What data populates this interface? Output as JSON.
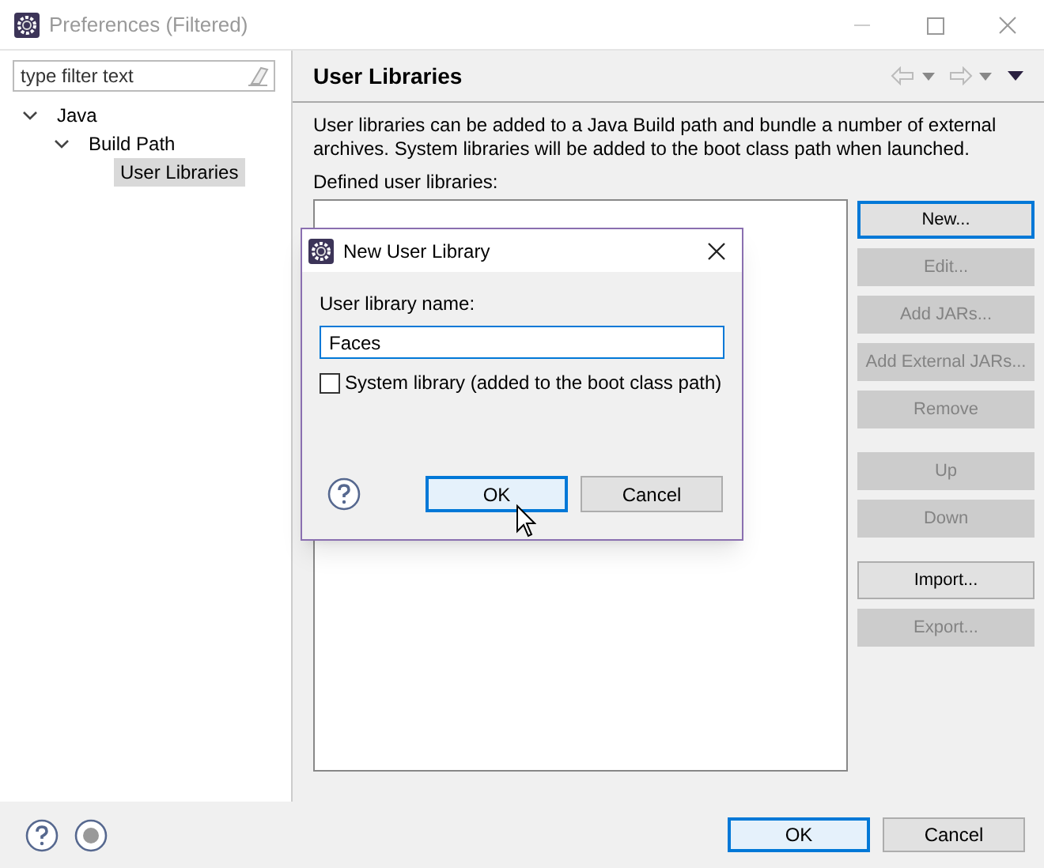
{
  "window": {
    "title": "Preferences (Filtered)"
  },
  "filter": {
    "placeholder": "type filter text"
  },
  "tree": [
    {
      "label": "Java",
      "expanded": true,
      "selected": false,
      "children": [
        {
          "label": "Build Path",
          "expanded": true,
          "selected": false,
          "children": [
            {
              "label": "User Libraries",
              "selected": true
            }
          ]
        }
      ]
    }
  ],
  "page": {
    "title": "User Libraries",
    "description": "User libraries can be added to a Java Build path and bundle a number of external archives. System libraries will be added to the boot class path when launched.",
    "list_label": "Defined user libraries:"
  },
  "side_button_groups": [
    [
      {
        "label": "New...",
        "disabled": false,
        "focused": true
      },
      {
        "label": "Edit...",
        "disabled": true,
        "focused": false
      },
      {
        "label": "Add JARs...",
        "disabled": true,
        "focused": false
      },
      {
        "label": "Add External JARs...",
        "disabled": true,
        "focused": false
      },
      {
        "label": "Remove",
        "disabled": true,
        "focused": false
      }
    ],
    [
      {
        "label": "Up",
        "disabled": true,
        "focused": false
      },
      {
        "label": "Down",
        "disabled": true,
        "focused": false
      }
    ],
    [
      {
        "label": "Import...",
        "disabled": false,
        "focused": false
      },
      {
        "label": "Export...",
        "disabled": true,
        "focused": false
      }
    ]
  ],
  "bottom_buttons": [
    {
      "label": "OK",
      "focused": true
    },
    {
      "label": "Cancel",
      "focused": false
    }
  ],
  "dialog": {
    "title": "New User Library",
    "name_label": "User library name:",
    "name_value": "Faces",
    "system_library": {
      "label": "System library (added to the boot class path)",
      "checked": false
    },
    "buttons": [
      {
        "label": "OK",
        "focused": true
      },
      {
        "label": "Cancel",
        "focused": false
      }
    ]
  }
}
